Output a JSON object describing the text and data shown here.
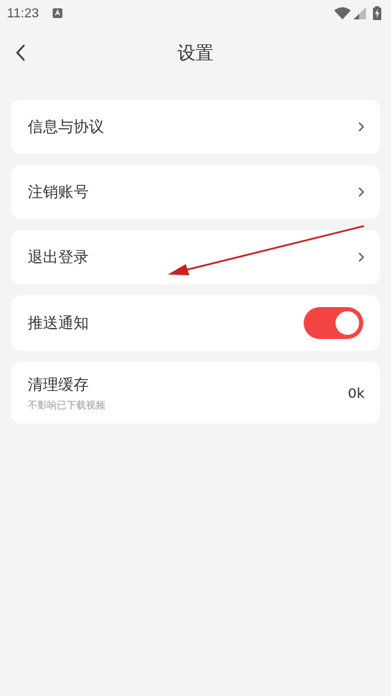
{
  "status_bar": {
    "time": "11:23"
  },
  "header": {
    "title": "设置"
  },
  "items": [
    {
      "kind": "link",
      "label": "信息与协议"
    },
    {
      "kind": "link",
      "label": "注销账号"
    },
    {
      "kind": "link",
      "label": "退出登录"
    },
    {
      "kind": "toggle",
      "label": "推送通知",
      "on": true
    },
    {
      "kind": "value",
      "label": "清理缓存",
      "subtitle": "不影响已下载视频",
      "value": "0k"
    }
  ]
}
